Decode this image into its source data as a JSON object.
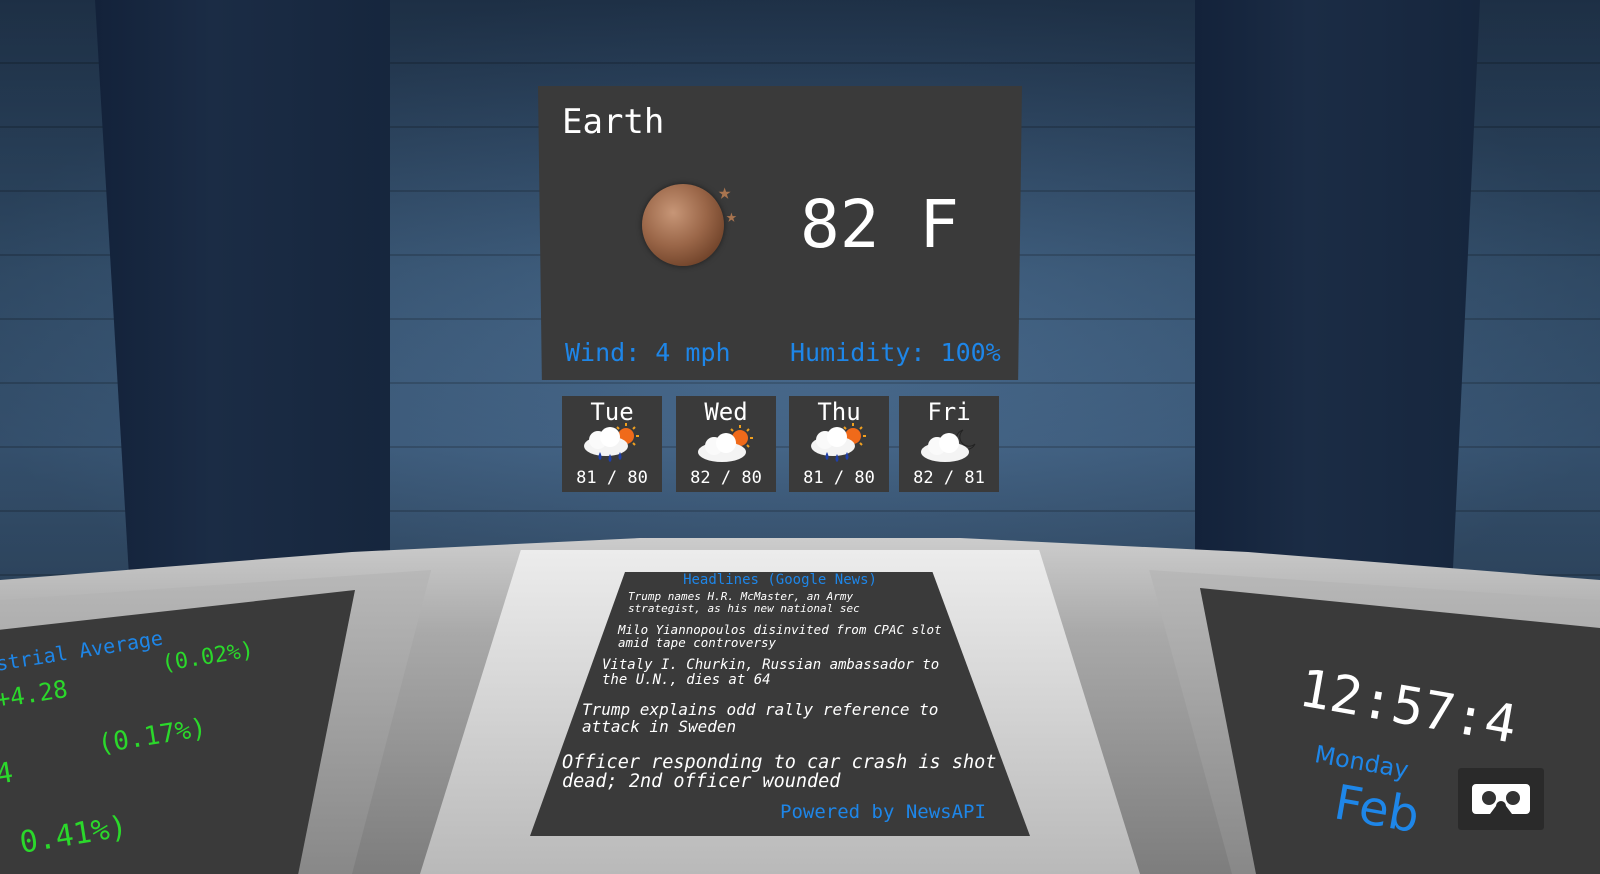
{
  "weather": {
    "location": "Earth",
    "temperature": "82 F",
    "current_icon": "moon-night-icon",
    "wind": "Wind: 4 mph",
    "humidity": "Humidity: 100%",
    "forecast": [
      {
        "day": "Tue",
        "icon": "rain-sun-icon",
        "range": "81 / 80"
      },
      {
        "day": "Wed",
        "icon": "cloud-sun-icon",
        "range": "82 / 80"
      },
      {
        "day": "Thu",
        "icon": "rain-sun-icon",
        "range": "81 / 80"
      },
      {
        "day": "Fri",
        "icon": "cloud-moon-icon",
        "range": "82 / 81"
      }
    ]
  },
  "headlines": {
    "title": "Headlines (Google News)",
    "items": [
      "Trump names H.R. McMaster, an Army strategist, as his new national sec",
      "Milo Yiannopoulos disinvited from CPAC slot amid tape controversy",
      "Vitaly I. Churkin, Russian ambassador to the U.N., dies at 64",
      "Trump explains odd rally reference to attack in Sweden",
      "Officer responding to car crash is shot dead; 2nd officer wounded"
    ],
    "powered_by": "Powered by NewsAPI"
  },
  "stocks": {
    "name": "strial Average",
    "change1": "+4.28",
    "pct1": "(0.02%)",
    "change2": "4",
    "pct2": "(0.17%)",
    "pct3": "0.41%)"
  },
  "clock": {
    "time": "12:57:4",
    "weekday": "Monday",
    "month": "Feb"
  },
  "colors": {
    "accent_blue": "#1e86e8",
    "stock_green": "#2bd82b",
    "panel_bg": "#3a3a3a"
  },
  "vr_button_icon": "vr-goggles-icon"
}
